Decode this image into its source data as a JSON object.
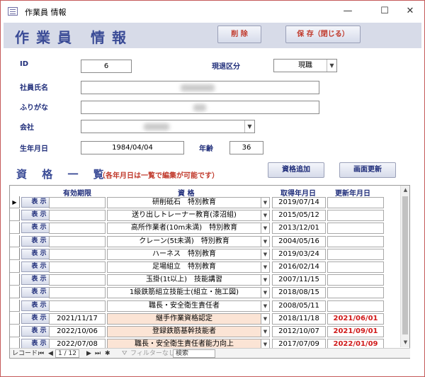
{
  "window": {
    "title": "作業員 情報",
    "minimize": "—",
    "maximize": "☐",
    "close": "✕"
  },
  "header": {
    "title": "作業員 情報",
    "delete_label": "削 除",
    "save_label": "保 存（閉じる）"
  },
  "form": {
    "id_label": "ID",
    "id_value": "6",
    "status_label": "現退区分",
    "status_value": "現職",
    "name_label": "社員氏名",
    "kana_label": "ふりがな",
    "company_label": "会社",
    "dob_label": "生年月日",
    "dob_value": "1984/04/04",
    "age_label": "年齢",
    "age_value": "36"
  },
  "section": {
    "title": "資 格 一 覧",
    "note": "（各年月日は一覧で編集が可能です）",
    "add_label": "資格追加",
    "refresh_label": "画面更新"
  },
  "table": {
    "columns": [
      "有効期限",
      "資 格",
      "取得年月日",
      "更新年月日"
    ],
    "show_label": "表 示",
    "rows": [
      {
        "expiry": "",
        "qualification": "研削砥石　特別教育",
        "acquired": "2019/07/14",
        "renewed": "",
        "highlight": false
      },
      {
        "expiry": "",
        "qualification": "送り出しトレーナー教育(漆沼組)",
        "acquired": "2015/05/12",
        "renewed": "",
        "highlight": false
      },
      {
        "expiry": "",
        "qualification": "高所作業者(10m未満)　特別教育",
        "acquired": "2013/12/01",
        "renewed": "",
        "highlight": false
      },
      {
        "expiry": "",
        "qualification": "クレーン(5t未満)　特別教育",
        "acquired": "2004/05/16",
        "renewed": "",
        "highlight": false
      },
      {
        "expiry": "",
        "qualification": "ハーネス　特別教育",
        "acquired": "2019/03/24",
        "renewed": "",
        "highlight": false
      },
      {
        "expiry": "",
        "qualification": "足場組立　特別教育",
        "acquired": "2016/02/14",
        "renewed": "",
        "highlight": false
      },
      {
        "expiry": "",
        "qualification": "玉掛(1t以上)　技能講習",
        "acquired": "2007/11/15",
        "renewed": "",
        "highlight": false
      },
      {
        "expiry": "",
        "qualification": "1級鉄筋組立技能士(組立・施工図)",
        "acquired": "2018/08/15",
        "renewed": "",
        "highlight": false
      },
      {
        "expiry": "",
        "qualification": "職長・安全衛生責任者",
        "acquired": "2008/05/11",
        "renewed": "",
        "highlight": false
      },
      {
        "expiry": "2021/11/17",
        "qualification": "継手作業資格認定",
        "acquired": "2018/11/18",
        "renewed": "2021/06/01",
        "highlight": true
      },
      {
        "expiry": "2022/10/06",
        "qualification": "登録鉄筋基幹技能者",
        "acquired": "2012/10/07",
        "renewed": "2021/09/01",
        "highlight": true
      },
      {
        "expiry": "2022/07/08",
        "qualification": "職長・安全衛生責任者能力向上",
        "acquired": "2017/07/09",
        "renewed": "2022/01/09",
        "highlight": true
      }
    ]
  },
  "navigation": {
    "record_label": "レコード:",
    "record_position": "1 / 12",
    "filter_label": "フィルターなし",
    "search_label": "検索"
  }
}
